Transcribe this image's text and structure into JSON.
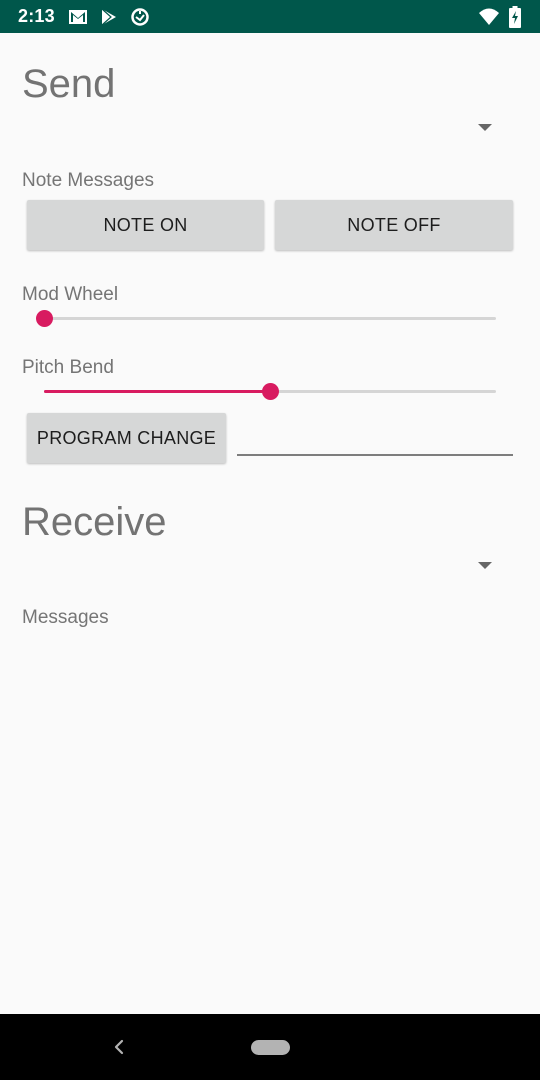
{
  "status_bar": {
    "time": "2:13",
    "background": "#00574b",
    "left_icons": [
      "gmail-icon",
      "play-store-icon",
      "data-saver-icon"
    ],
    "right_icons": [
      "wifi-icon",
      "battery-icon"
    ]
  },
  "send": {
    "title": "Send",
    "device_spinner_value": "",
    "note_messages_label": "Note Messages",
    "note_on_label": "NOTE ON",
    "note_off_label": "NOTE OFF",
    "mod_wheel_label": "Mod Wheel",
    "mod_wheel_value": 0.0,
    "pitch_bend_label": "Pitch Bend",
    "pitch_bend_value": 0.5,
    "program_change_label": "PROGRAM CHANGE",
    "program_value": ""
  },
  "receive": {
    "title": "Receive",
    "device_spinner_value": "",
    "messages_label": "Messages"
  },
  "colors": {
    "accent": "#d81b60",
    "button": "#d6d7d7",
    "title_text": "#737373"
  },
  "nav_bar": {
    "icons": [
      "back-icon",
      "home-pill-icon"
    ]
  }
}
